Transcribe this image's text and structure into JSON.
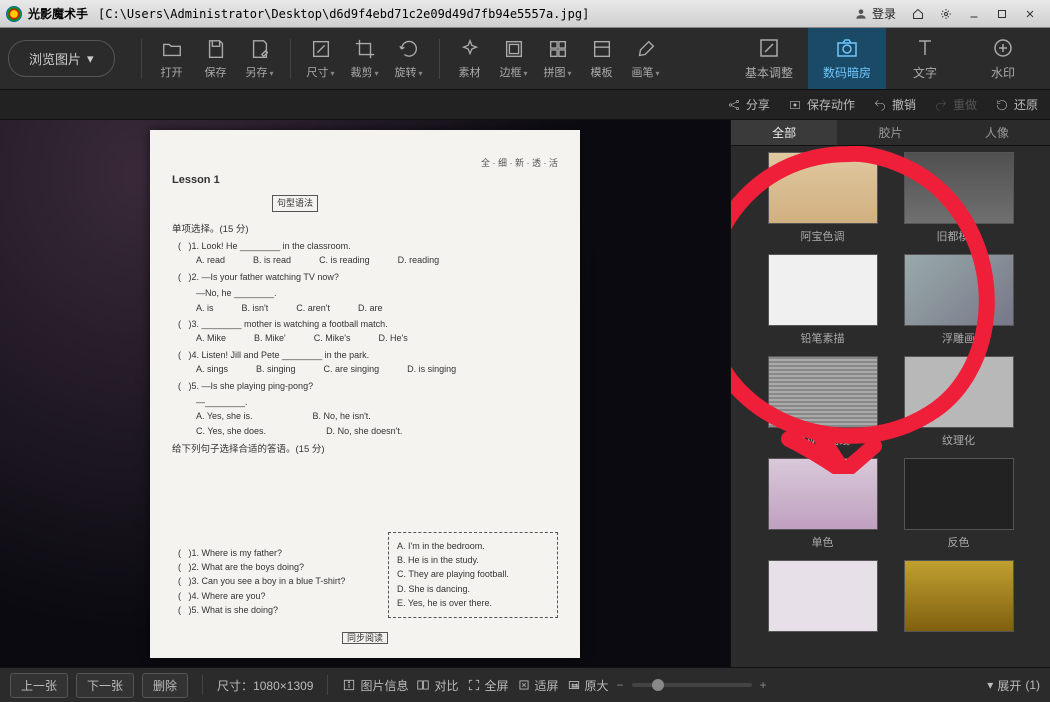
{
  "titlebar": {
    "app_name": "光影魔术手",
    "file_path": "[C:\\Users\\Administrator\\Desktop\\d6d9f4ebd71c2e09d49d7fb94e5557a.jpg]",
    "login": "登录"
  },
  "toolbar": {
    "browse": "浏览图片",
    "open": "打开",
    "save": "保存",
    "save_as": "另存",
    "size": "尺寸",
    "crop": "裁剪",
    "rotate": "旋转",
    "material": "素材",
    "border": "边框",
    "collage": "拼图",
    "template": "模板",
    "brush": "画笔"
  },
  "right_tabs": {
    "basic": "基本调整",
    "darkroom": "数码暗房",
    "text": "文字",
    "watermark": "水印"
  },
  "actionbar": {
    "share": "分享",
    "save_action": "保存动作",
    "undo": "撤销",
    "redo": "重做",
    "restore": "还原"
  },
  "filter_tabs": {
    "all": "全部",
    "film": "胶片",
    "portrait": "人像"
  },
  "presets": {
    "abao": "阿宝色调",
    "old": "旧都模式",
    "pencil": "铅笔素描",
    "relief": "浮雕画",
    "tv": "电视扫描线",
    "texture": "纹理化",
    "mono": "单色",
    "invert": "反色"
  },
  "bottombar": {
    "prev": "上一张",
    "next": "下一张",
    "delete": "删除",
    "size_label": "尺寸：",
    "size_value": "1080×1309",
    "info": "图片信息",
    "compare": "对比",
    "fullscreen": "全屏",
    "fit": "适屏",
    "original": "原大",
    "expand": "展开",
    "expand_count": "(1)"
  },
  "document": {
    "lesson": "Lesson 1",
    "top_right": "全 · 细 · 新 · 透 · 活",
    "grammar_box": "句型语法",
    "sec1": "单项选择。(15 分)",
    "q1": ")1. Look! He ________ in the classroom.",
    "q1a": "A. read",
    "q1b": "B. is read",
    "q1c": "C. is reading",
    "q1d": "D. reading",
    "q2": ")2. —Is your father watching TV now?",
    "q2line2": "—No, he ________.",
    "q2a": "A. is",
    "q2b": "B. isn't",
    "q2c": "C. aren't",
    "q2d": "D. are",
    "q3": ")3. ________ mother is watching a football match.",
    "q3a": "A. Mike",
    "q3b": "B. Mike'",
    "q3c": "C. Mike's",
    "q3d": "D. He's",
    "q4": ")4. Listen! Jill and Pete ________ in the park.",
    "q4a": "A. sings",
    "q4b": "B. singing",
    "q4c": "C. are singing",
    "q4d": "D. is singing",
    "q5": ")5. —Is she playing ping-pong?",
    "q5dash": "—________.",
    "q5a": "A. Yes, she is.",
    "q5b": "B. No, he isn't.",
    "q5c": "C. Yes, she does.",
    "q5d": "D. No, she doesn't.",
    "sec2": "给下列句子选择合适的答语。(15 分)",
    "p1": ")1. Where is my father?",
    "p2": ")2. What are the boys doing?",
    "p3": ")3. Can you see a boy in a blue T-shirt?",
    "p4": ")4. Where are you?",
    "p5": ")5. What is she doing?",
    "a1": "A. I'm in the bedroom.",
    "a2": "B. He is in the study.",
    "a3": "C. They are playing football.",
    "a4": "D. She is dancing.",
    "a5": "E. Yes, he is over there.",
    "footer": "同步阅读"
  }
}
